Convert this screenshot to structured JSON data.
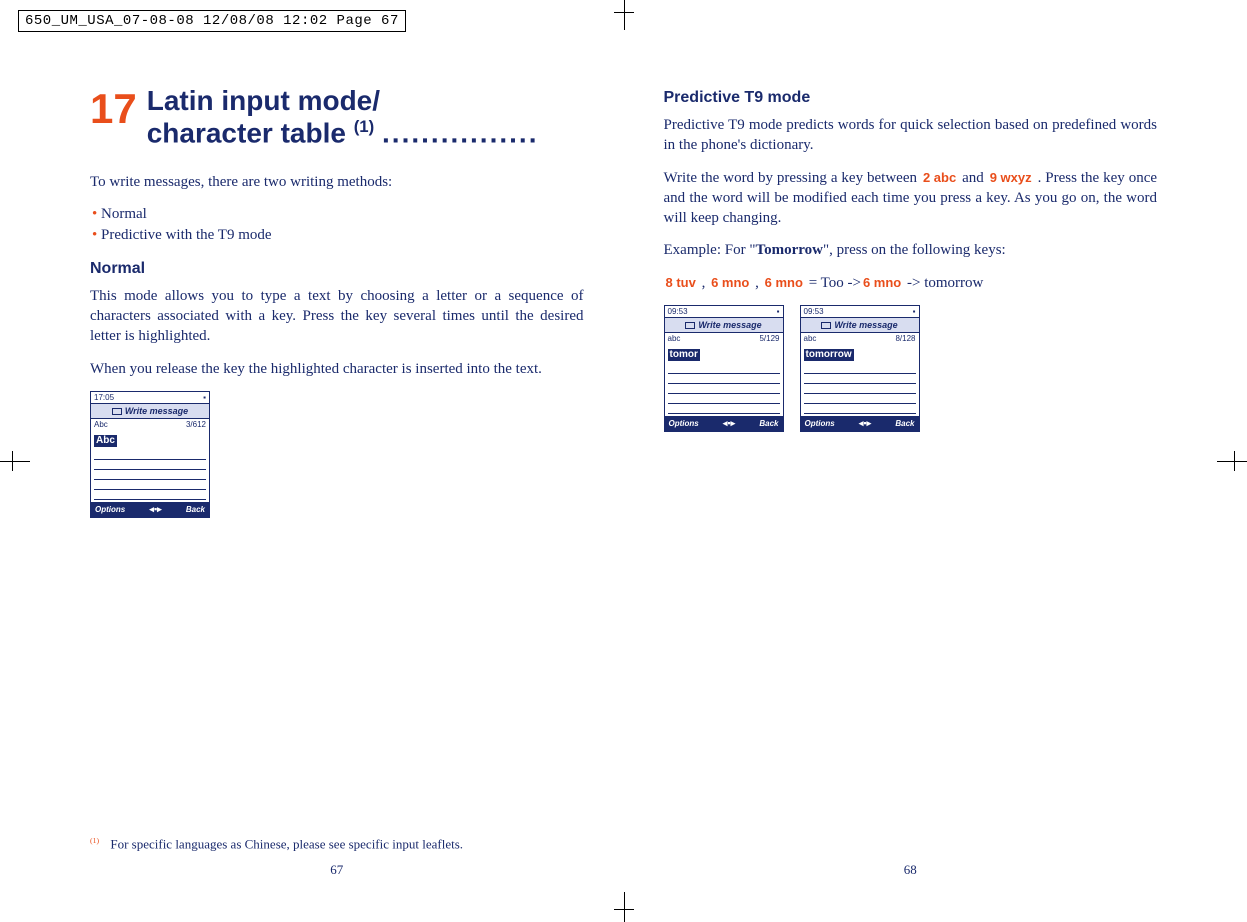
{
  "print_header": "650_UM_USA_07-08-08  12/08/08  12:02  Page 67",
  "left": {
    "chapter_num": "17",
    "title_line1": "Latin input mode/",
    "title_line2": "character table",
    "title_sup": "(1)",
    "title_dots": "................",
    "intro": "To write messages, there are two writing methods:",
    "bullet1": "Normal",
    "bullet2": "Predictive with the T9 mode",
    "section_normal": "Normal",
    "normal_p1": "This mode allows you to type a text by choosing a letter or a sequence of characters associated with a key. Press the key several times until the desired letter is highlighted.",
    "normal_p2": "When you release the key the highlighted character is inserted into the text.",
    "screen1": {
      "time": "17:05",
      "title": "Write message",
      "mode": "Abc",
      "count": "3/612",
      "text": "Abc",
      "left_soft": "Options",
      "right_soft": "Back"
    },
    "footnote_mark": "(1)",
    "footnote_text": "For specific languages as Chinese, please see specific input leaflets.",
    "pagenum": "67"
  },
  "right": {
    "section_t9": "Predictive T9 mode",
    "t9_p1": "Predictive T9 mode predicts words for quick selection based on predefined words in the phone's dictionary.",
    "t9_p2a": "Write the word by pressing a key between ",
    "key2": "2 abc",
    "t9_p2b": " and ",
    "key9": "9 wxyz",
    "t9_p2c": ". Press the key once and the word will be modified each time you press a key. As you go on, the word will keep changing.",
    "example_a": "Example: For \"",
    "example_word": "Tomorrow",
    "example_b": "\", press on the following keys:",
    "key8": "8 tuv",
    "key6": "6 mno",
    "seq_eq": " = Too ->",
    "seq_end": " -> tomorrow",
    "comma": " , ",
    "screen2": {
      "time": "09:53",
      "title": "Write message",
      "mode": "abc",
      "count": "5/129",
      "text": "tomor",
      "left_soft": "Options",
      "right_soft": "Back"
    },
    "screen3": {
      "time": "09:53",
      "title": "Write message",
      "mode": "abc",
      "count": "8/128",
      "text": "tomorrow",
      "left_soft": "Options",
      "right_soft": "Back"
    },
    "pagenum": "68"
  }
}
